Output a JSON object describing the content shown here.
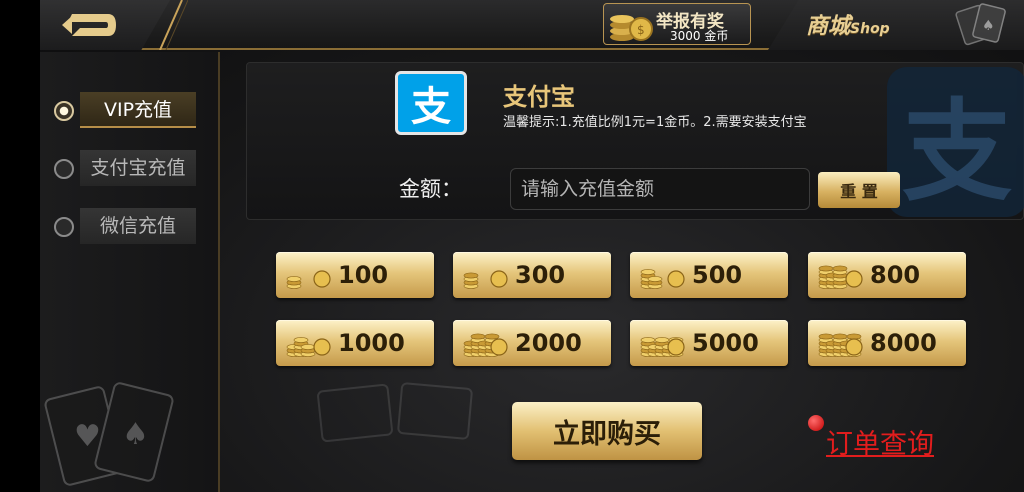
{
  "header": {
    "back_icon": "back-arrow-icon",
    "report": {
      "title": "举报有奖",
      "amount": "3000 金币"
    },
    "shop": {
      "title": "商城",
      "subtitle": "Shop"
    }
  },
  "sidebar": {
    "items": [
      {
        "label": "VIP充值",
        "active": true
      },
      {
        "label": "支付宝充值",
        "active": false
      },
      {
        "label": "微信充值",
        "active": false
      }
    ]
  },
  "payment": {
    "logo_char": "支",
    "name": "支付宝",
    "tip": "温馨提示:1.充值比例1元=1金币。2.需要安装支付宝",
    "amount_label": "金额：",
    "amount_placeholder": "请输入充值金额",
    "amount_value": "",
    "reset_label": "重 置",
    "background_char": "支"
  },
  "coin_options": [
    {
      "amount": "100"
    },
    {
      "amount": "300"
    },
    {
      "amount": "500"
    },
    {
      "amount": "800"
    },
    {
      "amount": "1000"
    },
    {
      "amount": "2000"
    },
    {
      "amount": "5000"
    },
    {
      "amount": "8000"
    }
  ],
  "actions": {
    "buy_label": "立即购买",
    "order_label": "订单查询"
  },
  "colors": {
    "gold": "#e2c072",
    "alipay_blue": "#00a1e9",
    "order_red": "#e21d1d"
  }
}
